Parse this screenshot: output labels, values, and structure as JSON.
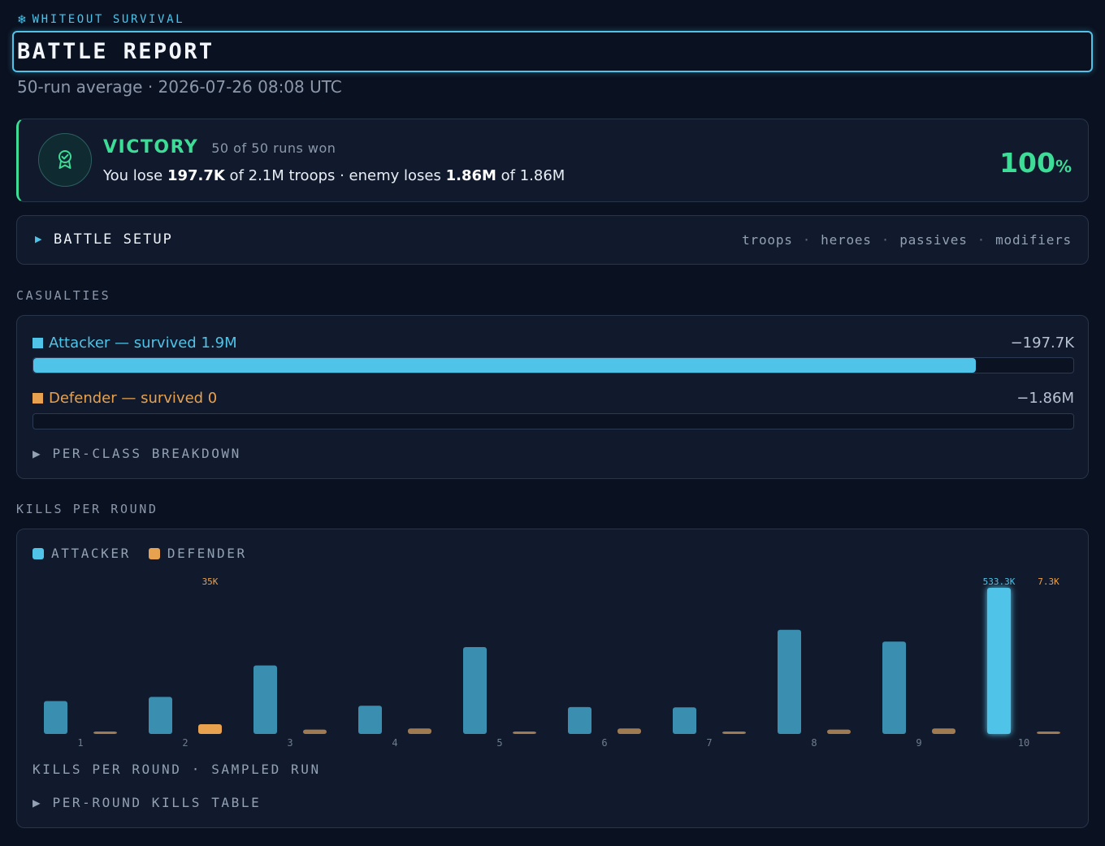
{
  "header": {
    "brand": "WHITEOUT SURVIVAL",
    "brand_icon": "snowflake-icon",
    "title": "BATTLE REPORT",
    "subtitle": "50-run average · 2026-07-26 08:08 UTC"
  },
  "victory": {
    "label": "VICTORY",
    "runs": "50 of 50 runs won",
    "pre": "You lose ",
    "you_lose": "197.7K",
    "mid1": " of 2.1M troops · enemy loses ",
    "enemy_loses": "1.86M",
    "mid2": " of 1.86M",
    "pct": "100",
    "pct_unit": "%",
    "icon": "medal-icon",
    "color": "#3ddc97"
  },
  "setup": {
    "label": "BATTLE SETUP",
    "links": [
      "troops",
      "heroes",
      "passives",
      "modifiers"
    ]
  },
  "casualties": {
    "section_label": "CASUALTIES",
    "attacker": {
      "label": "Attacker — survived 1.9M",
      "loss": "−197.7K",
      "survived_fraction": 0.906,
      "color": "#4fc3e8"
    },
    "defender": {
      "label": "Defender — survived 0",
      "loss": "−1.86M",
      "survived_fraction": 0,
      "color": "#e8a24f"
    },
    "breakdown": "PER-CLASS BREAKDOWN"
  },
  "kills": {
    "section_label": "KILLS PER ROUND",
    "legend": [
      {
        "label": "ATTACKER",
        "color": "#4fc3e8"
      },
      {
        "label": "DEFENDER",
        "color": "#e8a24f"
      }
    ],
    "caption": "KILLS PER ROUND · SAMPLED RUN",
    "table_toggle": "PER-ROUND KILLS TABLE"
  },
  "chart_data": {
    "type": "bar",
    "categories": [
      "1",
      "2",
      "3",
      "4",
      "5",
      "6",
      "7",
      "8",
      "9",
      "10"
    ],
    "series": [
      {
        "name": "ATTACKER",
        "values": [
          120000,
          135000,
          250000,
          103000,
          317000,
          98000,
          97000,
          380000,
          337000,
          533300
        ],
        "color": "#4fc3e8"
      },
      {
        "name": "DEFENDER",
        "values": [
          5000,
          35000,
          16000,
          20000,
          5000,
          20000,
          9000,
          16000,
          20000,
          7300
        ],
        "color": "#e8a24f"
      }
    ],
    "data_labels": [
      {
        "series": "DEFENDER",
        "category": "2",
        "text": "35K"
      },
      {
        "series": "ATTACKER",
        "category": "10",
        "text": "533.3K"
      },
      {
        "series": "DEFENDER",
        "category": "10",
        "text": "7.3K"
      }
    ],
    "ylim": [
      0,
      533300
    ],
    "grid": false
  }
}
